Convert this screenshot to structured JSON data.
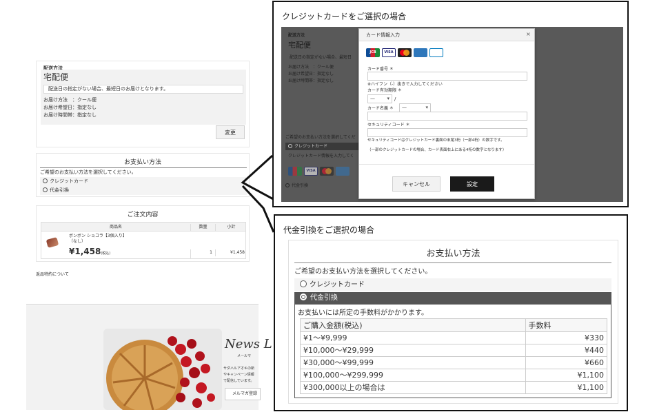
{
  "left": {
    "delivery": {
      "section_label": "配送方法",
      "method": "宅配便",
      "note": "配送日の指定がない場合、最短日のお届けとなります。",
      "lines": [
        "お届け方法　：クール便",
        "お届け希望日：指定なし",
        "お届け時間帯：指定なし"
      ],
      "change_button": "変更"
    },
    "payment": {
      "title": "お支払い方法",
      "prompt": "ご希望のお支払い方法を選択してください。",
      "options": [
        "クレジットカード",
        "代金引換"
      ]
    },
    "order": {
      "title": "ご注文内容",
      "columns": [
        "商品名",
        "数量",
        "小計"
      ],
      "item": {
        "name": "ボンボン ショコラ【3個入り】",
        "variant": "（なし）",
        "price": "¥1,458",
        "tax_note": "(税込)",
        "qty": "1",
        "subtotal": "¥1,458"
      }
    },
    "returns_link": "返品特約について",
    "news": {
      "title": "News L",
      "sub": "メールマ",
      "body_lines": [
        "サダハルアオキの新",
        "やキャンペーン情報",
        "で配信しています。"
      ],
      "button": "メルマガ登録"
    }
  },
  "credit": {
    "caption": "クレジットカードをご選択の場合",
    "bg": {
      "section_label": "配送方法",
      "method": "宅配便",
      "note": "配送日の指定がない場合、最短日",
      "lines": [
        "お届け方法　：クール便",
        "お届け希望日：指定なし",
        "お届け時間帯：指定なし"
      ],
      "prompt": "ご希望のお支払い方法を選択してくだ",
      "selected": "クレジットカード",
      "hint": "クレジットカード情報を入力してく",
      "cod": "代金引換"
    },
    "modal": {
      "title": "カード情報入力",
      "close": "×",
      "card_icons": [
        "JCB",
        "VISA",
        "MC",
        "AMEX",
        "DINERS"
      ],
      "number_label": "カード番号 ＊",
      "number_hint": "※ハイフン（-）抜きで入力してください",
      "expiry_label": "カード有効期限 ＊",
      "expiry_month": "—",
      "expiry_sep": "/",
      "expiry_year": "—",
      "name_label": "カード名義 ＊",
      "cvc_label": "セキュリティコード ＊",
      "cvc_note1": "セキュリティコードはクレジットカード裏面の末尾3桁（一部4桁）の数字です。",
      "cvc_note2": "（一部のクレジットカードの場合、カード表面右上にある4桁の数字となります）",
      "cancel": "キャンセル",
      "submit": "設定"
    }
  },
  "cod": {
    "caption": "代金引換をご選択の場合",
    "title": "お支払い方法",
    "prompt": "ご希望のお支払い方法を選択してください。",
    "option_credit": "クレジットカード",
    "option_cod": "代金引換",
    "fee_note": "お支払いには所定の手数料がかかります。",
    "fee_header": [
      "ご購入金額(税込)",
      "手数料"
    ],
    "fees": [
      [
        "¥1～¥9,999",
        "¥330"
      ],
      [
        "¥10,000～¥29,999",
        "¥440"
      ],
      [
        "¥30,000～¥99,999",
        "¥660"
      ],
      [
        "¥100,000～¥299,999",
        "¥1,100"
      ],
      [
        "¥300,000以上の場合は",
        "¥1,100"
      ]
    ]
  },
  "colors": {
    "selected_bar": "#555555",
    "modal_dark_button": "#1a1a1a",
    "overlay": "#555555"
  }
}
